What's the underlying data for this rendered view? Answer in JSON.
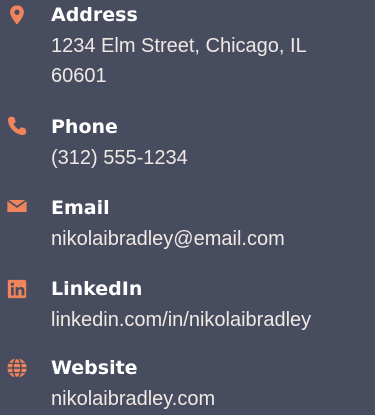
{
  "accent_color": "#f0845c",
  "contacts": [
    {
      "icon": "map-marker-icon",
      "label": "Address",
      "value_lines": [
        "1234 Elm Street, Chicago, IL",
        "60601"
      ]
    },
    {
      "icon": "phone-icon",
      "label": "Phone",
      "value_lines": [
        "(312) 555-1234"
      ]
    },
    {
      "icon": "envelope-icon",
      "label": "Email",
      "value_lines": [
        "nikolaibradley@email.com"
      ]
    },
    {
      "icon": "linkedin-icon",
      "label": "LinkedIn",
      "value_lines": [
        "linkedin.com/in/nikolaibradley"
      ]
    },
    {
      "icon": "globe-icon",
      "label": "Website",
      "value_lines": [
        "nikolaibradley.com"
      ]
    }
  ]
}
